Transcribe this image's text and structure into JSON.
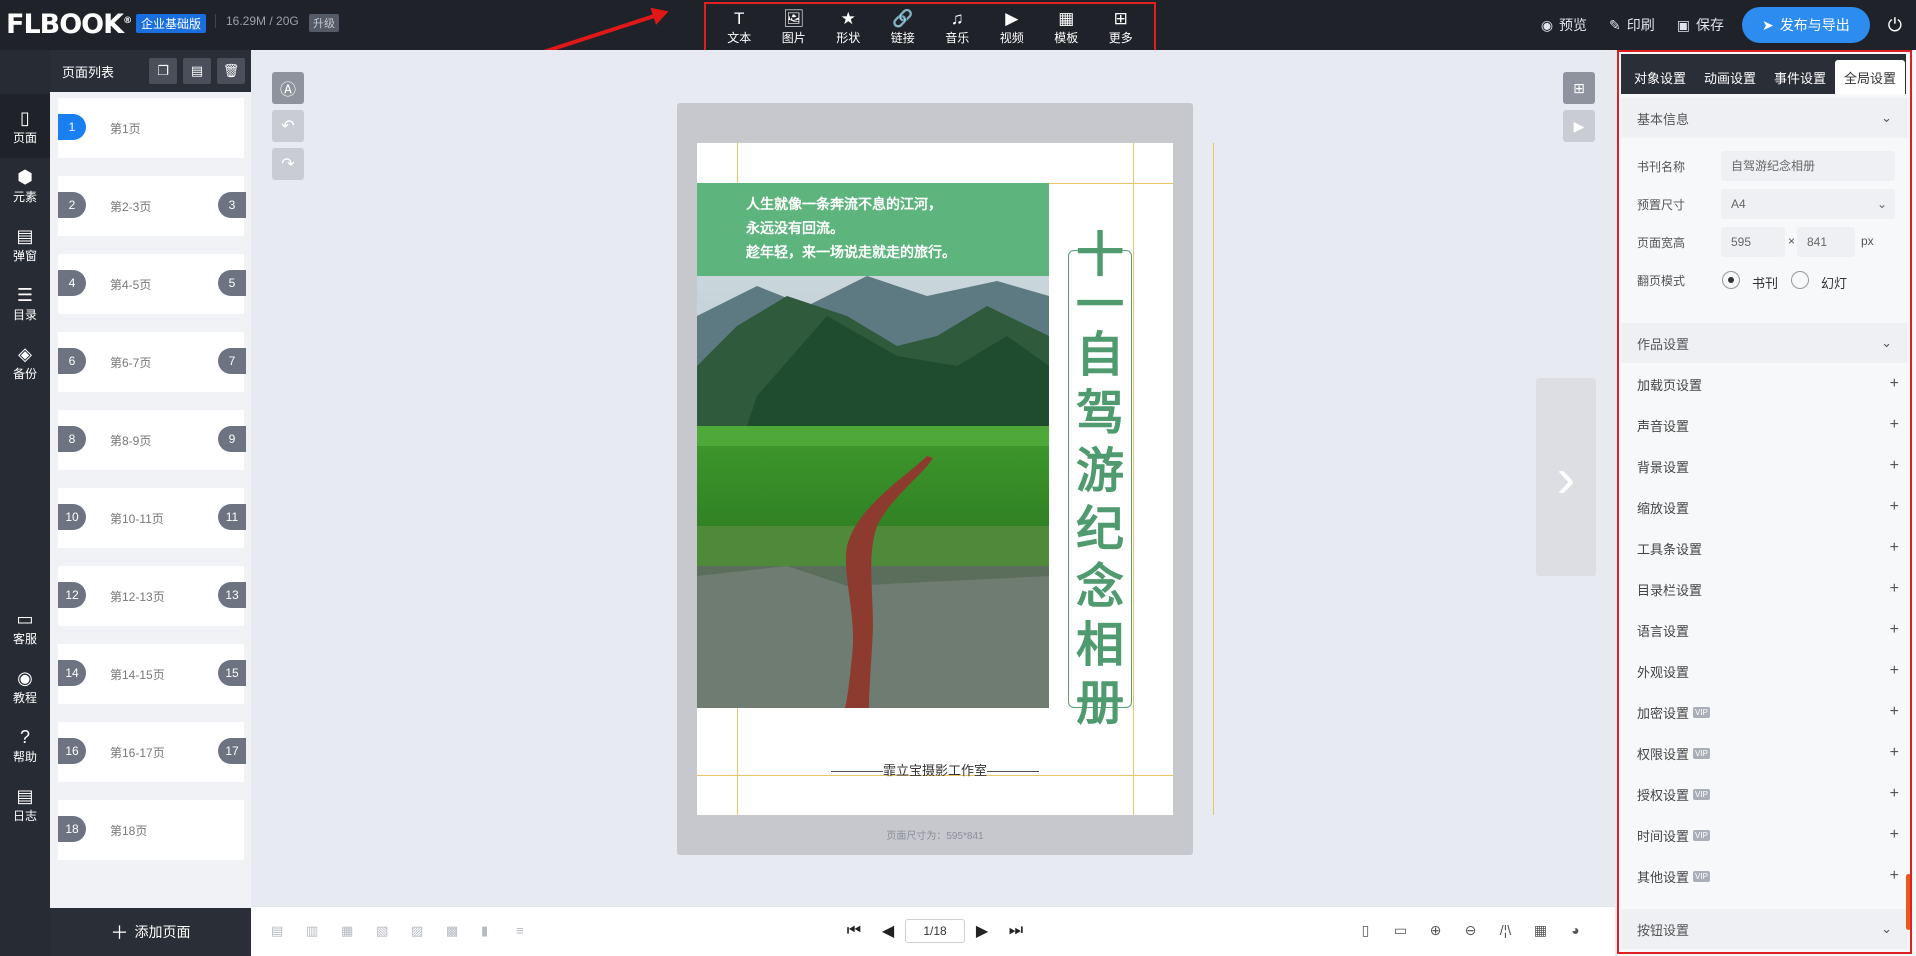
{
  "header": {
    "logo": "FLBOOK",
    "edition": "企业基础版",
    "storage": "16.29M / 20G",
    "upgrade": "升级",
    "tools": [
      {
        "label": "文本",
        "icon": "text-icon",
        "glyph": "T"
      },
      {
        "label": "图片",
        "icon": "image-icon",
        "glyph": "🖼"
      },
      {
        "label": "形状",
        "icon": "star-icon",
        "glyph": "★"
      },
      {
        "label": "链接",
        "icon": "link-icon",
        "glyph": "🔗"
      },
      {
        "label": "音乐",
        "icon": "music-icon",
        "glyph": "♫"
      },
      {
        "label": "视频",
        "icon": "video-icon",
        "glyph": "▶"
      },
      {
        "label": "模板",
        "icon": "template-icon",
        "glyph": "▦"
      },
      {
        "label": "更多",
        "icon": "more-icon",
        "glyph": "⊞"
      }
    ],
    "preview": "预览",
    "print": "印刷",
    "save": "保存",
    "publish": "发布与导出"
  },
  "left_nav": [
    {
      "label": "页面",
      "icon": "page-icon",
      "glyph": "▯"
    },
    {
      "label": "元素",
      "icon": "elements-icon",
      "glyph": "⬢"
    },
    {
      "label": "弹窗",
      "icon": "popup-icon",
      "glyph": "▤"
    },
    {
      "label": "目录",
      "icon": "catalog-icon",
      "glyph": "☰"
    },
    {
      "label": "备份",
      "icon": "backup-icon",
      "glyph": "◈"
    },
    {
      "label": "客服",
      "icon": "service-icon",
      "glyph": "▭"
    },
    {
      "label": "教程",
      "icon": "tutorial-icon",
      "glyph": "◉"
    },
    {
      "label": "帮助",
      "icon": "help-icon",
      "glyph": "?"
    },
    {
      "label": "日志",
      "icon": "log-icon",
      "glyph": "▤"
    }
  ],
  "page_panel": {
    "title": "页面列表",
    "add_page": "添加页面",
    "pages": [
      {
        "left": "1",
        "right": "",
        "label": "第1页",
        "active": true
      },
      {
        "left": "2",
        "right": "3",
        "label": "第2-3页"
      },
      {
        "left": "4",
        "right": "5",
        "label": "第4-5页"
      },
      {
        "left": "6",
        "right": "7",
        "label": "第6-7页"
      },
      {
        "left": "8",
        "right": "9",
        "label": "第8-9页"
      },
      {
        "left": "10",
        "right": "11",
        "label": "第10-11页"
      },
      {
        "left": "12",
        "right": "13",
        "label": "第12-13页"
      },
      {
        "left": "14",
        "right": "15",
        "label": "第14-15页"
      },
      {
        "left": "16",
        "right": "17",
        "label": "第16-17页"
      },
      {
        "left": "18",
        "right": "",
        "label": "第18页"
      }
    ]
  },
  "canvas": {
    "poem": [
      "人生就像一条奔流不息的江河，",
      "永远没有回流。",
      "趁年轻，来一场说走就走的旅行。"
    ],
    "title_chars": [
      "十",
      "一",
      "自",
      "驾",
      "游",
      "纪",
      "念",
      "相",
      "册"
    ],
    "studio": "————霏立宝摄影工作室————",
    "page_size_note": "页面尺寸为：595*841"
  },
  "bottom_bar": {
    "page_indicator": "1/18"
  },
  "right_panel": {
    "tabs": [
      {
        "label": "对象设置"
      },
      {
        "label": "动画设置"
      },
      {
        "label": "事件设置"
      },
      {
        "label": "全局设置",
        "active": true
      }
    ],
    "basic_info": "基本信息",
    "book_name_label": "书刊名称",
    "book_name_value": "自驾游纪念相册",
    "preset_size_label": "预置尺寸",
    "preset_size_value": "A4",
    "page_size_label": "页面宽高",
    "page_width": "595",
    "page_height": "841",
    "times": "×",
    "unit": "px",
    "flip_mode_label": "翻页模式",
    "flip_mode_options": [
      "书刊",
      "幻灯"
    ],
    "work_settings": "作品设置",
    "settings": [
      {
        "label": "加载页设置",
        "vip": false
      },
      {
        "label": "声音设置",
        "vip": false
      },
      {
        "label": "背景设置",
        "vip": false
      },
      {
        "label": "缩放设置",
        "vip": false
      },
      {
        "label": "工具条设置",
        "vip": false
      },
      {
        "label": "目录栏设置",
        "vip": false
      },
      {
        "label": "语言设置",
        "vip": false
      },
      {
        "label": "外观设置",
        "vip": false
      },
      {
        "label": "加密设置",
        "vip": true
      },
      {
        "label": "权限设置",
        "vip": true
      },
      {
        "label": "授权设置",
        "vip": true
      },
      {
        "label": "时间设置",
        "vip": true
      },
      {
        "label": "其他设置",
        "vip": true
      }
    ],
    "vip_badge": "VIP",
    "button_settings": "按钮设置"
  },
  "colors": {
    "topbar": "#1f2229",
    "accent": "#2d8cf0",
    "highlight_frame": "#e02020",
    "green_band": "#5eb47d",
    "title_green": "#4f9a6e"
  }
}
